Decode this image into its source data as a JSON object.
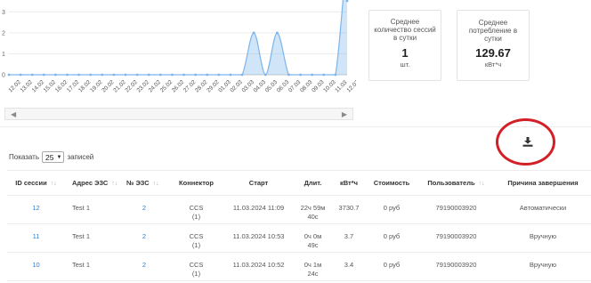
{
  "chart_data": {
    "type": "area",
    "categories": [
      "12.02",
      "13.02",
      "14.02",
      "15.02",
      "16.02",
      "17.02",
      "18.02",
      "19.02",
      "20.02",
      "21.02",
      "22.02",
      "23.02",
      "24.02",
      "25.02",
      "26.02",
      "27.02",
      "28.02",
      "29.02",
      "01.03",
      "02.03",
      "03.03",
      "04.03",
      "05.03",
      "06.03",
      "07.03",
      "08.03",
      "09.03",
      "10.03",
      "11.03",
      "12.03"
    ],
    "values": [
      0,
      0,
      0,
      0,
      0,
      0,
      0,
      0,
      0,
      0,
      0,
      0,
      0,
      0,
      0,
      0,
      0,
      0,
      0,
      0,
      0,
      2,
      0,
      2,
      0,
      0,
      0,
      0,
      0,
      6
    ],
    "yticks": [
      0,
      1,
      2,
      3
    ],
    "ylim": [
      0,
      3.4
    ],
    "title": "",
    "xlabel": "",
    "ylabel": "",
    "color": "#7cb5ec"
  },
  "stats": {
    "avg_sessions": {
      "title": "Среднее количество сессий в сутки",
      "value": "1",
      "unit": "шт."
    },
    "avg_consumption": {
      "title": "Среднее потребление в сутки",
      "value": "129.67",
      "unit": "кВт*ч"
    }
  },
  "scrollbar": {
    "left_arrow": "◀",
    "right_arrow": "▶"
  },
  "controls": {
    "show_prefix": "Показать",
    "page_size": "25",
    "show_suffix": "записей",
    "export_icon": "download-icon"
  },
  "table": {
    "headers": [
      "ID сессии",
      "Адрес ЭЗС",
      "№ ЭЗС",
      "Коннектор",
      "Старт",
      "Длит.",
      "кВт*ч",
      "Стоимость",
      "Пользователь",
      "Причина завершения"
    ],
    "rows": [
      {
        "id": "12",
        "address": "Test 1",
        "station": "2",
        "connector": "CCS",
        "connector_num": "(1)",
        "start": "11.03.2024 11:09",
        "duration": "22ч 59м",
        "duration2": "40с",
        "kwh": "3730.7",
        "cost": "0 руб",
        "user": "79190003920",
        "reason": "Автоматически"
      },
      {
        "id": "11",
        "address": "Test 1",
        "station": "2",
        "connector": "CCS",
        "connector_num": "(1)",
        "start": "11.03.2024 10:53",
        "duration": "0ч 0м",
        "duration2": "49с",
        "kwh": "3.7",
        "cost": "0 руб",
        "user": "79190003920",
        "reason": "Вручную"
      },
      {
        "id": "10",
        "address": "Test 1",
        "station": "2",
        "connector": "CCS",
        "connector_num": "(1)",
        "start": "11.03.2024 10:52",
        "duration": "0ч 1м",
        "duration2": "24с",
        "kwh": "3.4",
        "cost": "0 руб",
        "user": "79190003920",
        "reason": "Вручную"
      }
    ]
  },
  "colors": {
    "link": "#2a7fd0",
    "annotation": "#d31f26",
    "series": "#7cb5ec"
  }
}
